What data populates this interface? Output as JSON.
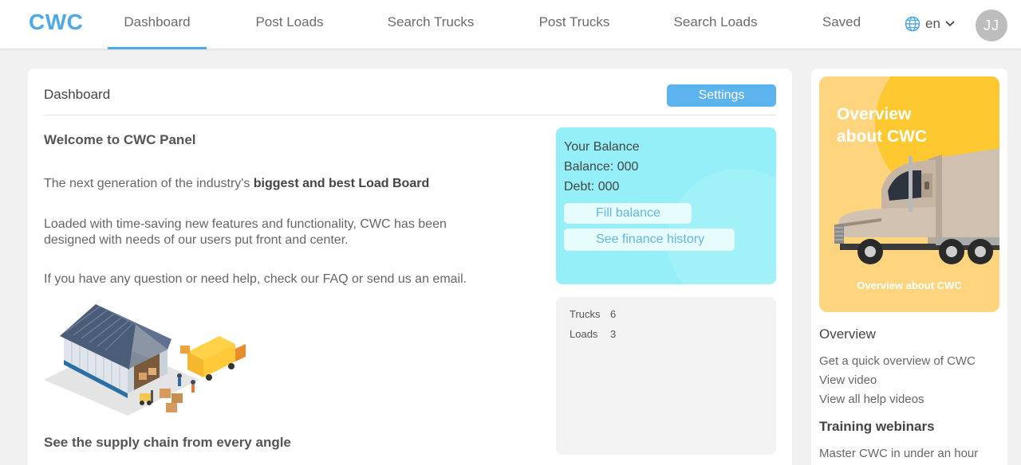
{
  "header": {
    "logo": "CWC",
    "nav": [
      {
        "label": "Dashboard"
      },
      {
        "label": "Post Loads"
      },
      {
        "label": "Search Trucks"
      },
      {
        "label": "Post Trucks"
      },
      {
        "label": "Search Loads"
      },
      {
        "label": "Saved"
      }
    ],
    "active_nav": "Dashboard",
    "language": "en",
    "avatar_initials": "JJ",
    "icons": {
      "language": "globe-icon",
      "language_dropdown": "chevron-down-icon"
    }
  },
  "dashboard": {
    "title": "Dashboard",
    "settings_label": "Settings",
    "welcome": "Welcome to CWC Panel",
    "intro_prefix": "The next generation of the industry's ",
    "intro_bold": "biggest and best Load Board",
    "features": "Loaded with time-saving new features and functionality, CWC has been designed with needs of our users put front and center.",
    "help": "If you have any question or need help, check our FAQ or send us an email.",
    "supply_heading": "See the supply chain from every angle"
  },
  "balance": {
    "title": "Your Balance",
    "balance_line": "Balance: 000",
    "debt_line": "Debt: 000",
    "fill_label": "Fill balance",
    "history_label": "See finance history"
  },
  "stats": [
    {
      "label": "Trucks",
      "value": "6"
    },
    {
      "label": "Loads",
      "value": "3"
    }
  ],
  "sidebar": {
    "promo_title": "Overview about CWC",
    "promo_caption": "Overview about CWC",
    "overview_heading": "Overview",
    "overview_links": [
      "Get a quick overview of CWC",
      "View video",
      "View all help videos"
    ],
    "training_heading": "Training webinars",
    "training_links": [
      "Master CWC in under an hour"
    ]
  },
  "colors": {
    "accent": "#4da9ea",
    "balance_bg": "#95eff8",
    "promo_bg": "#fed57e"
  }
}
